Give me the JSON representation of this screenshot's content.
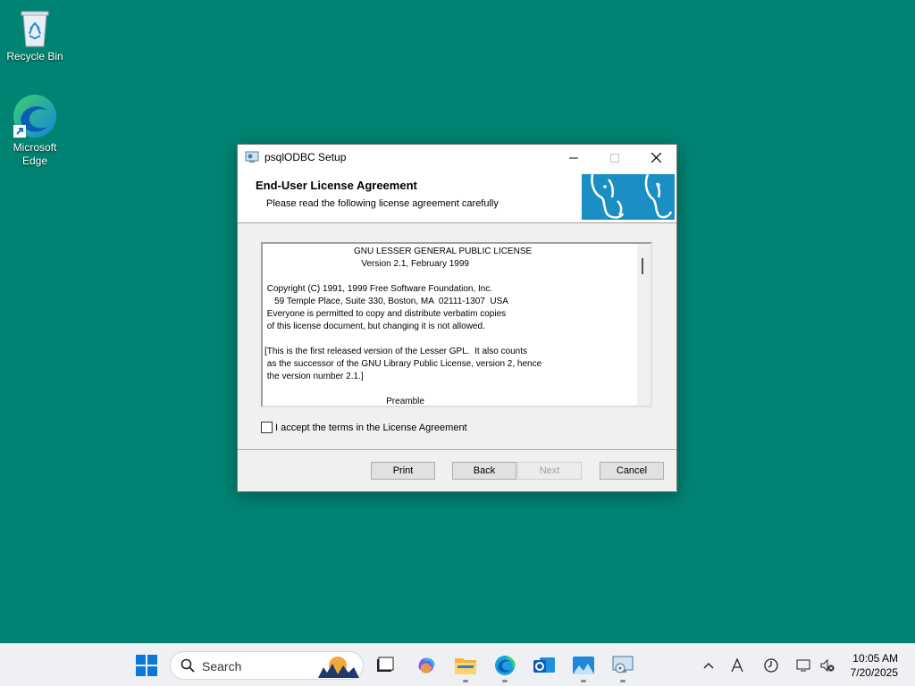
{
  "desktop": {
    "icons": [
      {
        "label": "Recycle Bin",
        "icon": "recycle-bin-icon"
      },
      {
        "label": "Microsoft Edge",
        "icon": "edge-icon"
      }
    ]
  },
  "dialog": {
    "title": "psqlODBC Setup",
    "header_title": "End-User License Agreement",
    "header_subtitle": "Please read the following license agreement carefully",
    "license_lines": [
      "                                    GNU LESSER GENERAL PUBLIC LICENSE",
      "                                       Version 2.1, February 1999",
      "",
      " Copyright (C) 1991, 1999 Free Software Foundation, Inc.",
      "    59 Temple Place, Suite 330, Boston, MA  02111-1307  USA",
      " Everyone is permitted to copy and distribute verbatim copies",
      " of this license document, but changing it is not allowed.",
      "",
      "[This is the first released version of the Lesser GPL.  It also counts",
      " as the successor of the GNU Library Public License, version 2, hence",
      " the version number 2.1.]",
      "",
      "                                                 Preamble"
    ],
    "accept_label": "I accept the terms in the License Agreement",
    "accept_checked": false,
    "buttons": {
      "print": "Print",
      "back": "Back",
      "next": "Next",
      "cancel": "Cancel"
    }
  },
  "taskbar": {
    "search_label": "Search",
    "time": "10:05 AM",
    "date": "7/20/2025"
  },
  "colors": {
    "desktop_bg": "#008373",
    "logo_bg": "#1b8fc4"
  }
}
